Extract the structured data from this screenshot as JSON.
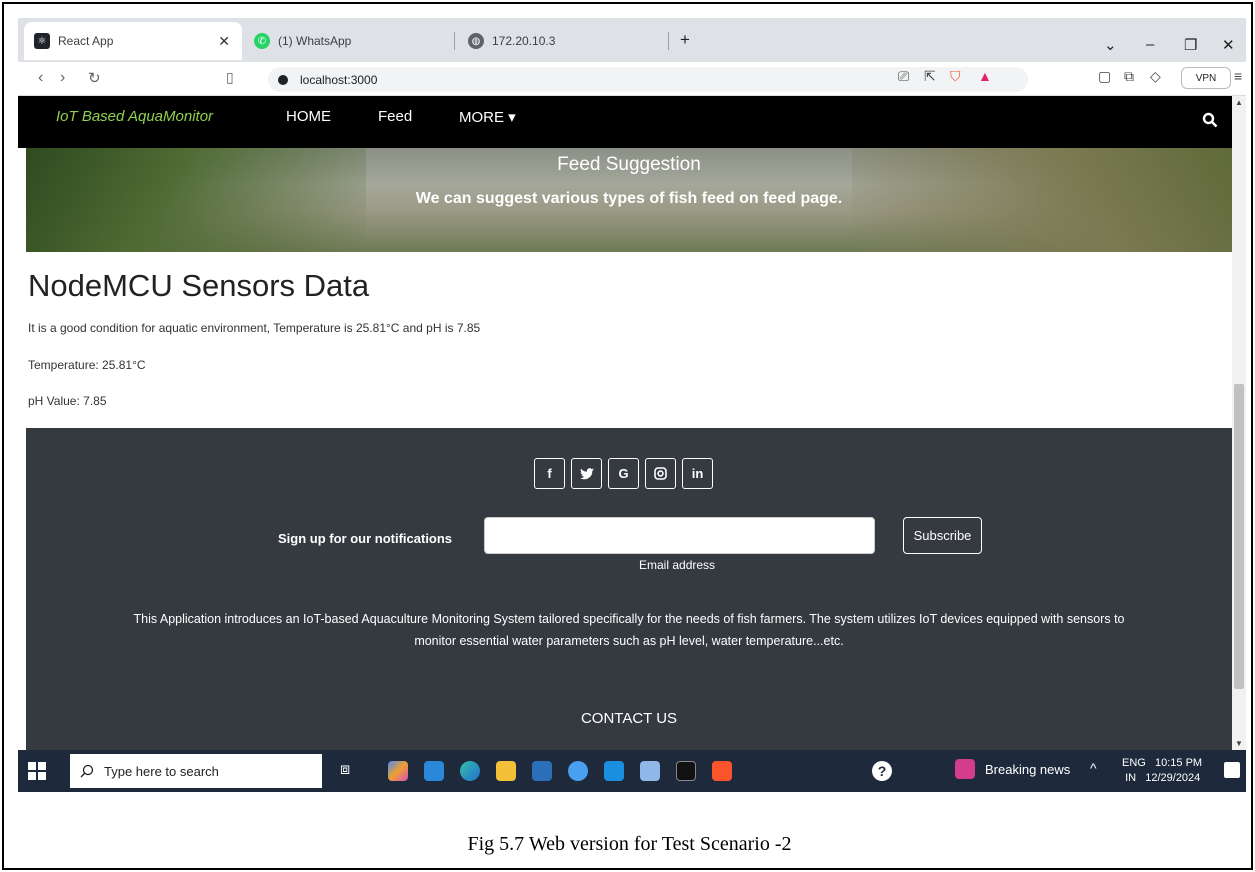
{
  "browser": {
    "tabs": [
      {
        "label": "React App",
        "icon": "react-icon",
        "color": "#20232a"
      },
      {
        "label": "(1) WhatsApp",
        "icon": "whatsapp-icon",
        "color": "#25d366"
      },
      {
        "label": "172.20.10.3",
        "icon": "globe-icon",
        "color": "#5f6368"
      }
    ],
    "address": "localhost:3000",
    "vpn_label": "VPN"
  },
  "app": {
    "brand": "IoT Based AquaMonitor",
    "brand_color": "#8fd14f",
    "nav": [
      "HOME",
      "Feed",
      "MORE"
    ],
    "hero": {
      "title": "Feed Suggestion",
      "subtitle": "We can suggest various types of fish feed on feed page."
    },
    "sensors": {
      "heading": "NodeMCU Sensors Data",
      "status": "It is a good condition for aquatic environment, Temperature is 25.81°C and pH is 7.85",
      "temperature": "Temperature: 25.81°C",
      "ph": "pH Value: 7.85"
    },
    "footer": {
      "social": [
        "f",
        "t",
        "G",
        "ig",
        "in"
      ],
      "signup_label": "Sign up for our notifications",
      "email_label": "Email address",
      "subscribe": "Subscribe",
      "description": "This Application introduces an IoT-based Aquaculture Monitoring System tailored specifically for the needs of fish farmers. The system utilizes IoT devices equipped with sensors to monitor essential water parameters such as pH level, water temperature...etc.",
      "contact": "CONTACT US",
      "bg_color": "#343a40"
    }
  },
  "taskbar": {
    "search_placeholder": "Type here to search",
    "news": "Breaking news",
    "lang_top": "ENG",
    "lang_bottom": "IN",
    "time": "10:15 PM",
    "date": "12/29/2024"
  },
  "caption": "Fig 5.7 Web version for Test Scenario -2"
}
